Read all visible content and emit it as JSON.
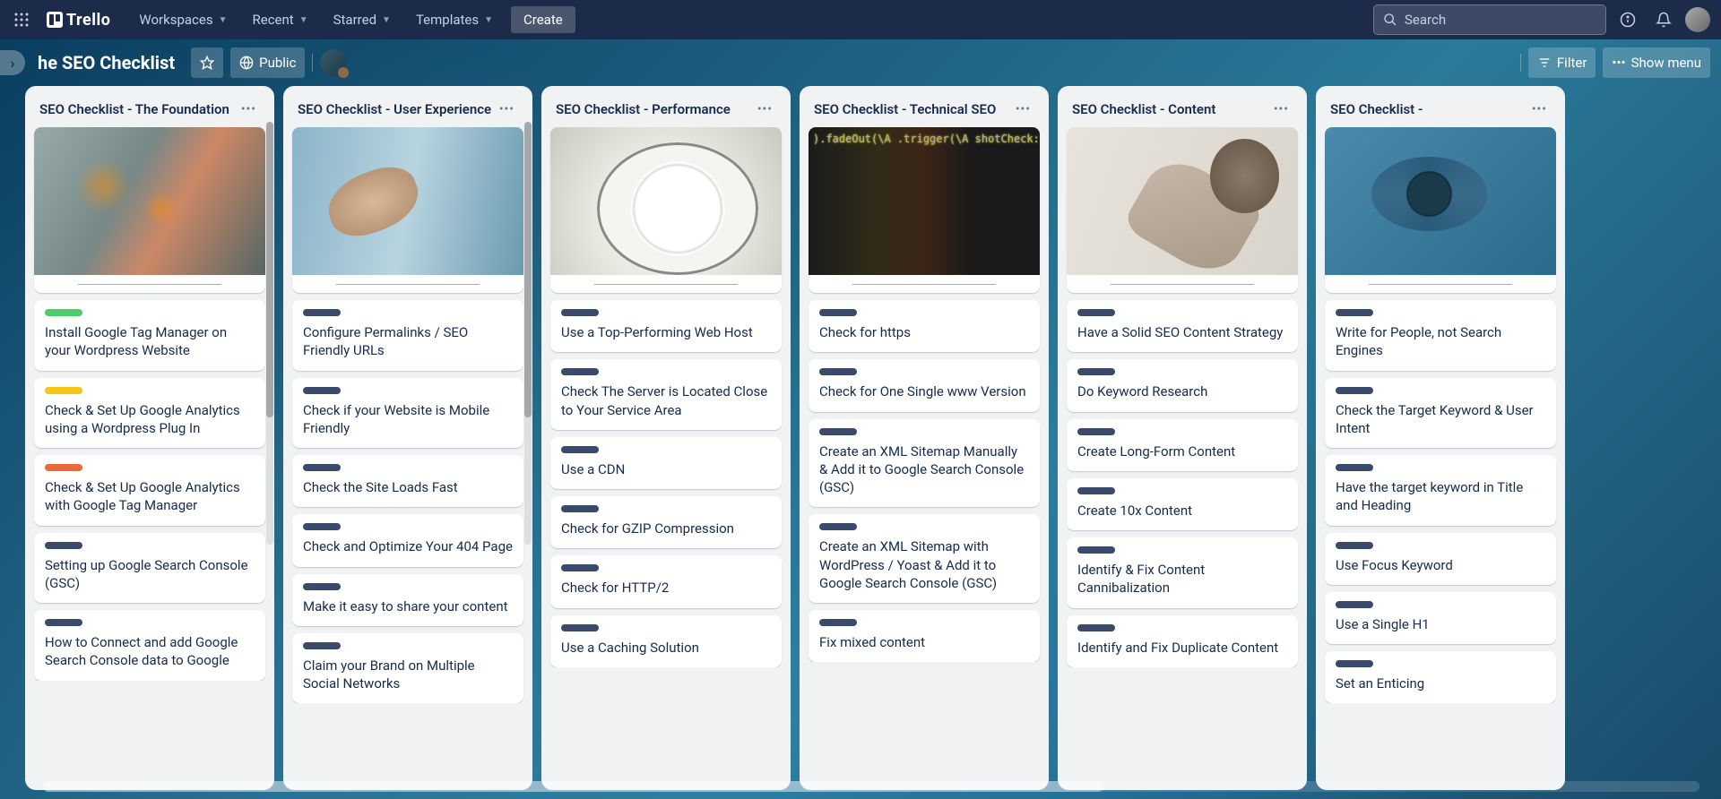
{
  "topbar": {
    "logo_text": "Trello",
    "nav": [
      "Workspaces",
      "Recent",
      "Starred",
      "Templates"
    ],
    "create": "Create",
    "search_placeholder": "Search"
  },
  "boardbar": {
    "title": "he SEO Checklist",
    "visibility": "Public",
    "filter": "Filter",
    "menu": "Show menu"
  },
  "lists": [
    {
      "title": "SEO Checklist - The Foundation",
      "cover": "cov1",
      "has_scroll": true,
      "cards": [
        {
          "label": "l-green",
          "text": "Install Google Tag Manager on your Wordpress Website"
        },
        {
          "label": "l-yellow",
          "text": "Check & Set Up Google Analytics using a Wordpress Plug In"
        },
        {
          "label": "l-orange",
          "text": "Check & Set Up Google Analytics with Google Tag Manager"
        },
        {
          "label": "l-navy",
          "text": "Setting up Google Search Console (GSC)"
        },
        {
          "label": "l-navy",
          "text": "How to Connect and add Google Search Console data to Google"
        }
      ]
    },
    {
      "title": "SEO Checklist - User Experience",
      "cover": "cov2",
      "has_scroll": true,
      "cards": [
        {
          "label": "l-navy",
          "text": "Configure Permalinks / SEO Friendly URLs"
        },
        {
          "label": "l-navy",
          "text": "Check if your Website is Mobile Friendly"
        },
        {
          "label": "l-navy",
          "text": "Check the Site Loads Fast"
        },
        {
          "label": "l-navy",
          "text": "Check and Optimize Your 404 Page"
        },
        {
          "label": "l-navy",
          "text": "Make it easy to share your content"
        },
        {
          "label": "l-navy",
          "text": "Claim your Brand on Multiple Social Networks"
        }
      ]
    },
    {
      "title": "SEO Checklist - Performance",
      "cover": "cov3",
      "has_scroll": false,
      "cards": [
        {
          "label": "l-navy",
          "text": "Use a Top-Performing Web Host"
        },
        {
          "label": "l-navy",
          "text": "Check The Server is Located Close to Your Service Area"
        },
        {
          "label": "l-navy",
          "text": "Use a CDN"
        },
        {
          "label": "l-navy",
          "text": "Check for GZIP Compression"
        },
        {
          "label": "l-navy",
          "text": "Check for HTTP/2"
        },
        {
          "label": "l-navy",
          "text": "Use a Caching Solution"
        }
      ]
    },
    {
      "title": "SEO Checklist - Technical SEO",
      "cover": "cov4",
      "has_scroll": false,
      "cards": [
        {
          "label": "l-navy",
          "text": "Check for https"
        },
        {
          "label": "l-navy",
          "text": "Check for One Single www Version"
        },
        {
          "label": "l-navy",
          "text": "Create an XML Sitemap Manually & Add it to Google Search Console (GSC)"
        },
        {
          "label": "l-navy",
          "text": "Create an XML Sitemap with WordPress / Yoast & Add it to Google Search Console (GSC)"
        },
        {
          "label": "l-navy",
          "text": "Fix mixed content"
        }
      ]
    },
    {
      "title": "SEO Checklist - Content",
      "cover": "cov5",
      "has_scroll": false,
      "cards": [
        {
          "label": "l-navy",
          "text": "Have a Solid SEO Content Strategy"
        },
        {
          "label": "l-navy",
          "text": "Do Keyword Research"
        },
        {
          "label": "l-navy",
          "text": "Create Long-Form Content"
        },
        {
          "label": "l-navy",
          "text": "Create 10x Content"
        },
        {
          "label": "l-navy",
          "text": "Identify & Fix Content Cannibalization"
        },
        {
          "label": "l-navy",
          "text": "Identify and Fix Duplicate Content"
        }
      ]
    },
    {
      "title": "SEO Checklist -",
      "cover": "cov6",
      "has_scroll": false,
      "cards": [
        {
          "label": "l-navy",
          "text": "Write for People, not Search Engines"
        },
        {
          "label": "l-navy",
          "text": "Check the Target Keyword & User Intent"
        },
        {
          "label": "l-navy",
          "text": "Have the target keyword in Title and Heading"
        },
        {
          "label": "l-navy",
          "text": "Use Focus Keyword"
        },
        {
          "label": "l-navy",
          "text": "Use a Single H1"
        },
        {
          "label": "l-navy",
          "text": "Set an Enticing"
        }
      ]
    }
  ]
}
